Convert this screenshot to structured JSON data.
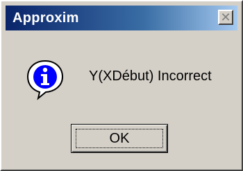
{
  "window": {
    "title": "Approxim",
    "close_glyph": "✕"
  },
  "message": {
    "icon": "info-icon",
    "text": "Y(XDébut) Incorrect"
  },
  "buttons": {
    "ok_label": "OK"
  },
  "colors": {
    "titlebar_start": "#0a246a",
    "titlebar_end": "#a6caf0",
    "dialog_face": "#d4d0c8",
    "info_blue": "#0000ff"
  }
}
